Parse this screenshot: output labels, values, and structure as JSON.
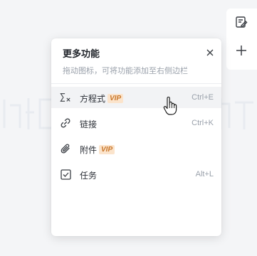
{
  "panel": {
    "title": "更多功能",
    "subtitle": "拖动图标，可将功能添加至右侧边栏",
    "items": [
      {
        "label": "方程式",
        "badge": "VIP",
        "shortcut": "Ctrl+E",
        "icon": "equation-icon"
      },
      {
        "label": "链接",
        "badge": "",
        "shortcut": "Ctrl+K",
        "icon": "link-icon"
      },
      {
        "label": "附件",
        "badge": "VIP",
        "shortcut": "",
        "icon": "attachment-icon"
      },
      {
        "label": "任务",
        "badge": "",
        "shortcut": "Alt+L",
        "icon": "task-icon"
      }
    ]
  },
  "rail": {
    "buttons": [
      "edit-note-icon",
      "plus-icon"
    ]
  }
}
